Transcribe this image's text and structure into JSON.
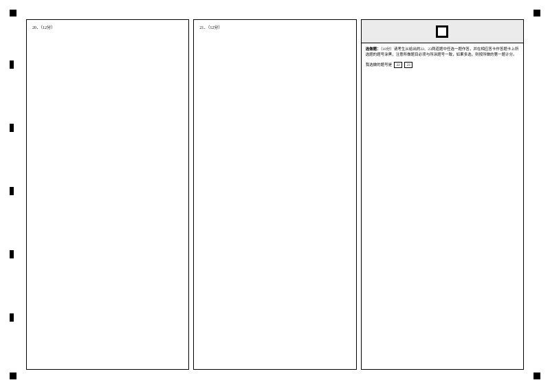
{
  "fiducials": {
    "side_tick_tops": [
      88,
      180,
      272,
      364,
      456
    ]
  },
  "columns": {
    "col1": {
      "label": "20．（12分）"
    },
    "col2": {
      "label": "21．（12分）"
    },
    "col3": {
      "section_title": "选做题：",
      "instruction": "（10分）请考生从给出的22、23两道题中任选一题作答，并在相应答卡作答题卡上所选题的题号涂黑，注意所做题目必须与所涂题号一致，如果多选，则按所做的第一题计分。",
      "select_label": "我选做的题号是",
      "options": [
        "22",
        "23"
      ]
    }
  }
}
